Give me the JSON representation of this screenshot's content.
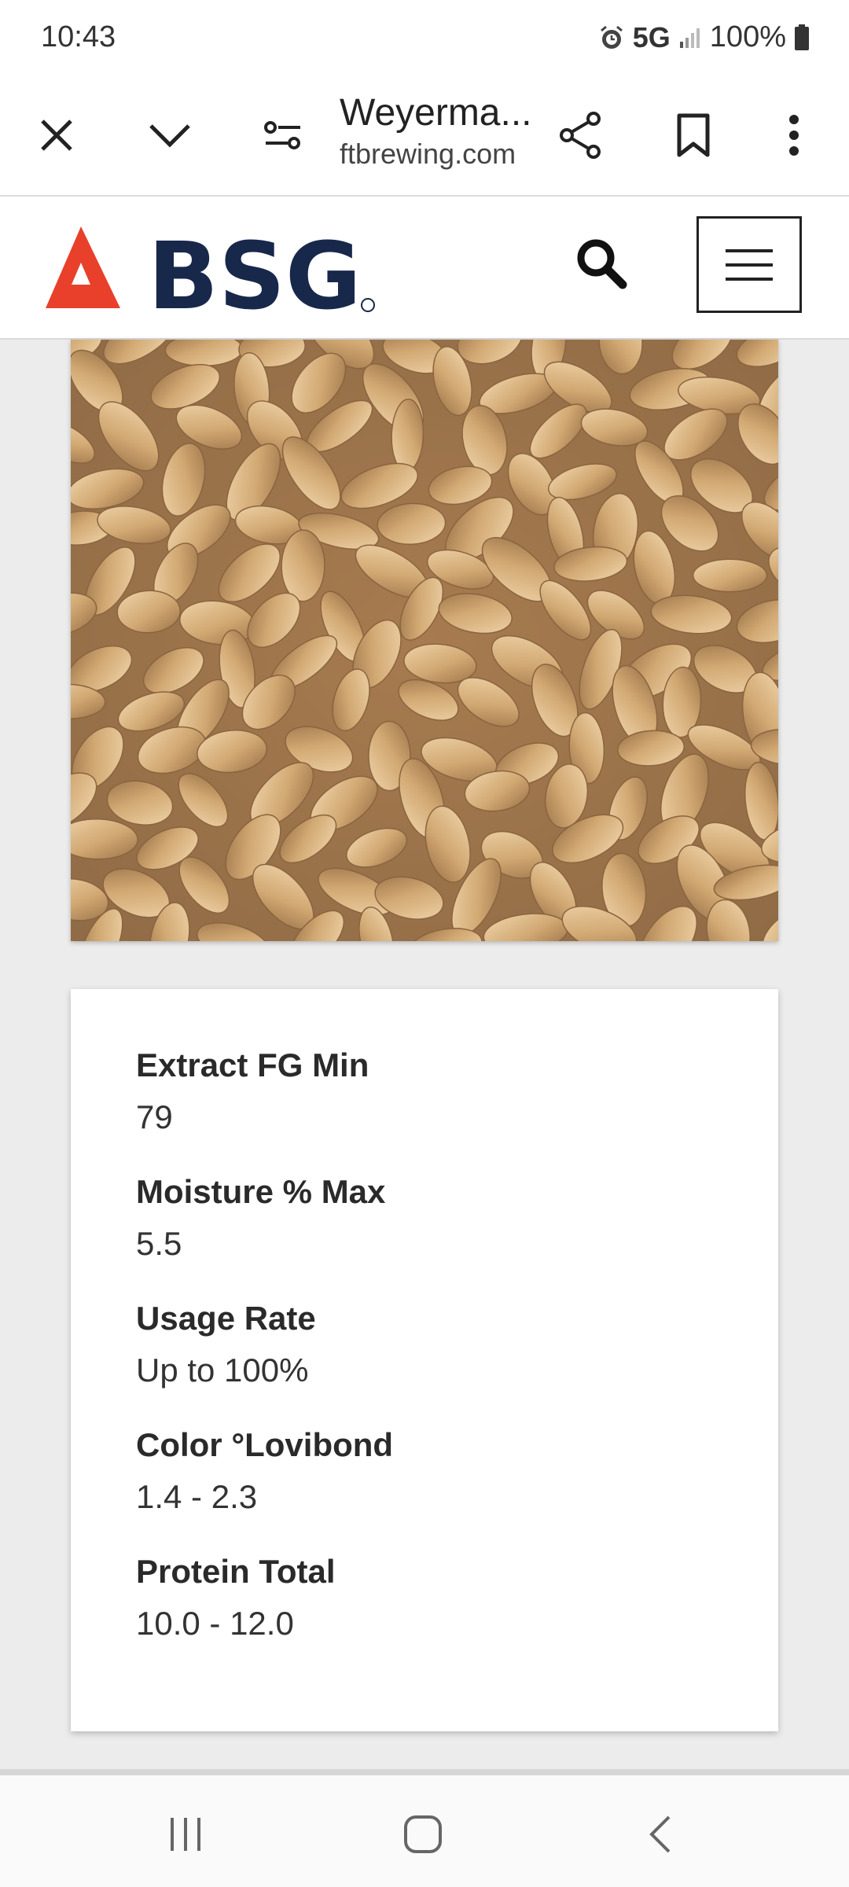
{
  "status_bar": {
    "time": "10:43",
    "network": "5G",
    "battery": "100%"
  },
  "browser": {
    "page_title": "Weyerma...",
    "domain": "ftbrewing.com",
    "icons": [
      "close-icon",
      "chevron-down-icon",
      "site-settings-icon",
      "share-icon",
      "bookmark-icon",
      "more-vert-icon"
    ]
  },
  "site": {
    "logo_text": "BSG",
    "accent_color": "#e8402b",
    "brand_color": "#17284b"
  },
  "specs": [
    {
      "label": "Extract FG Min",
      "value": "79"
    },
    {
      "label": "Moisture % Max",
      "value": "5.5"
    },
    {
      "label": "Usage Rate",
      "value": "Up to 100%"
    },
    {
      "label": "Color °Lovibond",
      "value": "1.4 - 2.3"
    },
    {
      "label": "Protein Total",
      "value": "10.0 - 12.0"
    }
  ],
  "nav": {
    "icons": [
      "recent-apps-icon",
      "home-icon",
      "back-icon"
    ]
  }
}
